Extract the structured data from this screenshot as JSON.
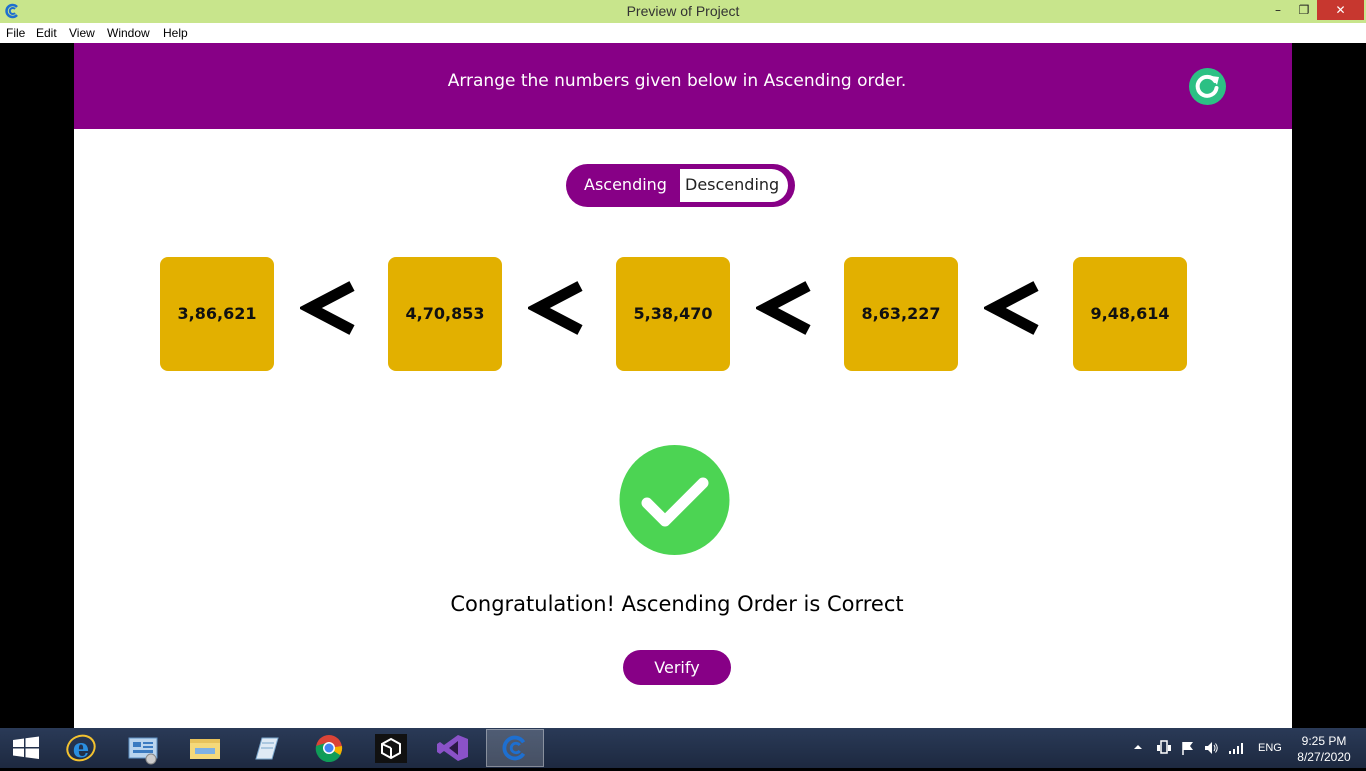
{
  "window": {
    "title": "Preview of Project",
    "min_glyph": "–",
    "max_glyph": "❐",
    "close_glyph": "✕"
  },
  "menu": {
    "items": [
      "File",
      "Edit",
      "View",
      "Window",
      "Help"
    ]
  },
  "header": {
    "instruction": "Arrange the numbers given below in Ascending order.",
    "reset_icon": "refresh-icon"
  },
  "toggle": {
    "ascending_label": "Ascending",
    "descending_label": "Descending",
    "selected": "Ascending"
  },
  "numbers": [
    "3,86,621",
    "4,70,853",
    "5,38,470",
    "8,63,227",
    "9,48,614"
  ],
  "comparator_icon": "less-than-icon",
  "result": {
    "icon": "check-circle-icon",
    "message": "Congratulation! Ascending Order is Correct"
  },
  "verify_label": "Verify",
  "colors": {
    "header": "#870086",
    "card": "#e2b000",
    "success": "#4cd453",
    "reset": "#2cc084",
    "titlebar": "#c8e58c"
  },
  "taskbar": {
    "apps": [
      "start-icon",
      "internet-explorer-icon",
      "server-manager-icon",
      "file-explorer-icon",
      "notes-icon",
      "chrome-icon",
      "unity-icon",
      "visual-studio-icon",
      "project-app-icon"
    ],
    "language": "ENG",
    "time": "9:25 PM",
    "date": "8/27/2020"
  }
}
